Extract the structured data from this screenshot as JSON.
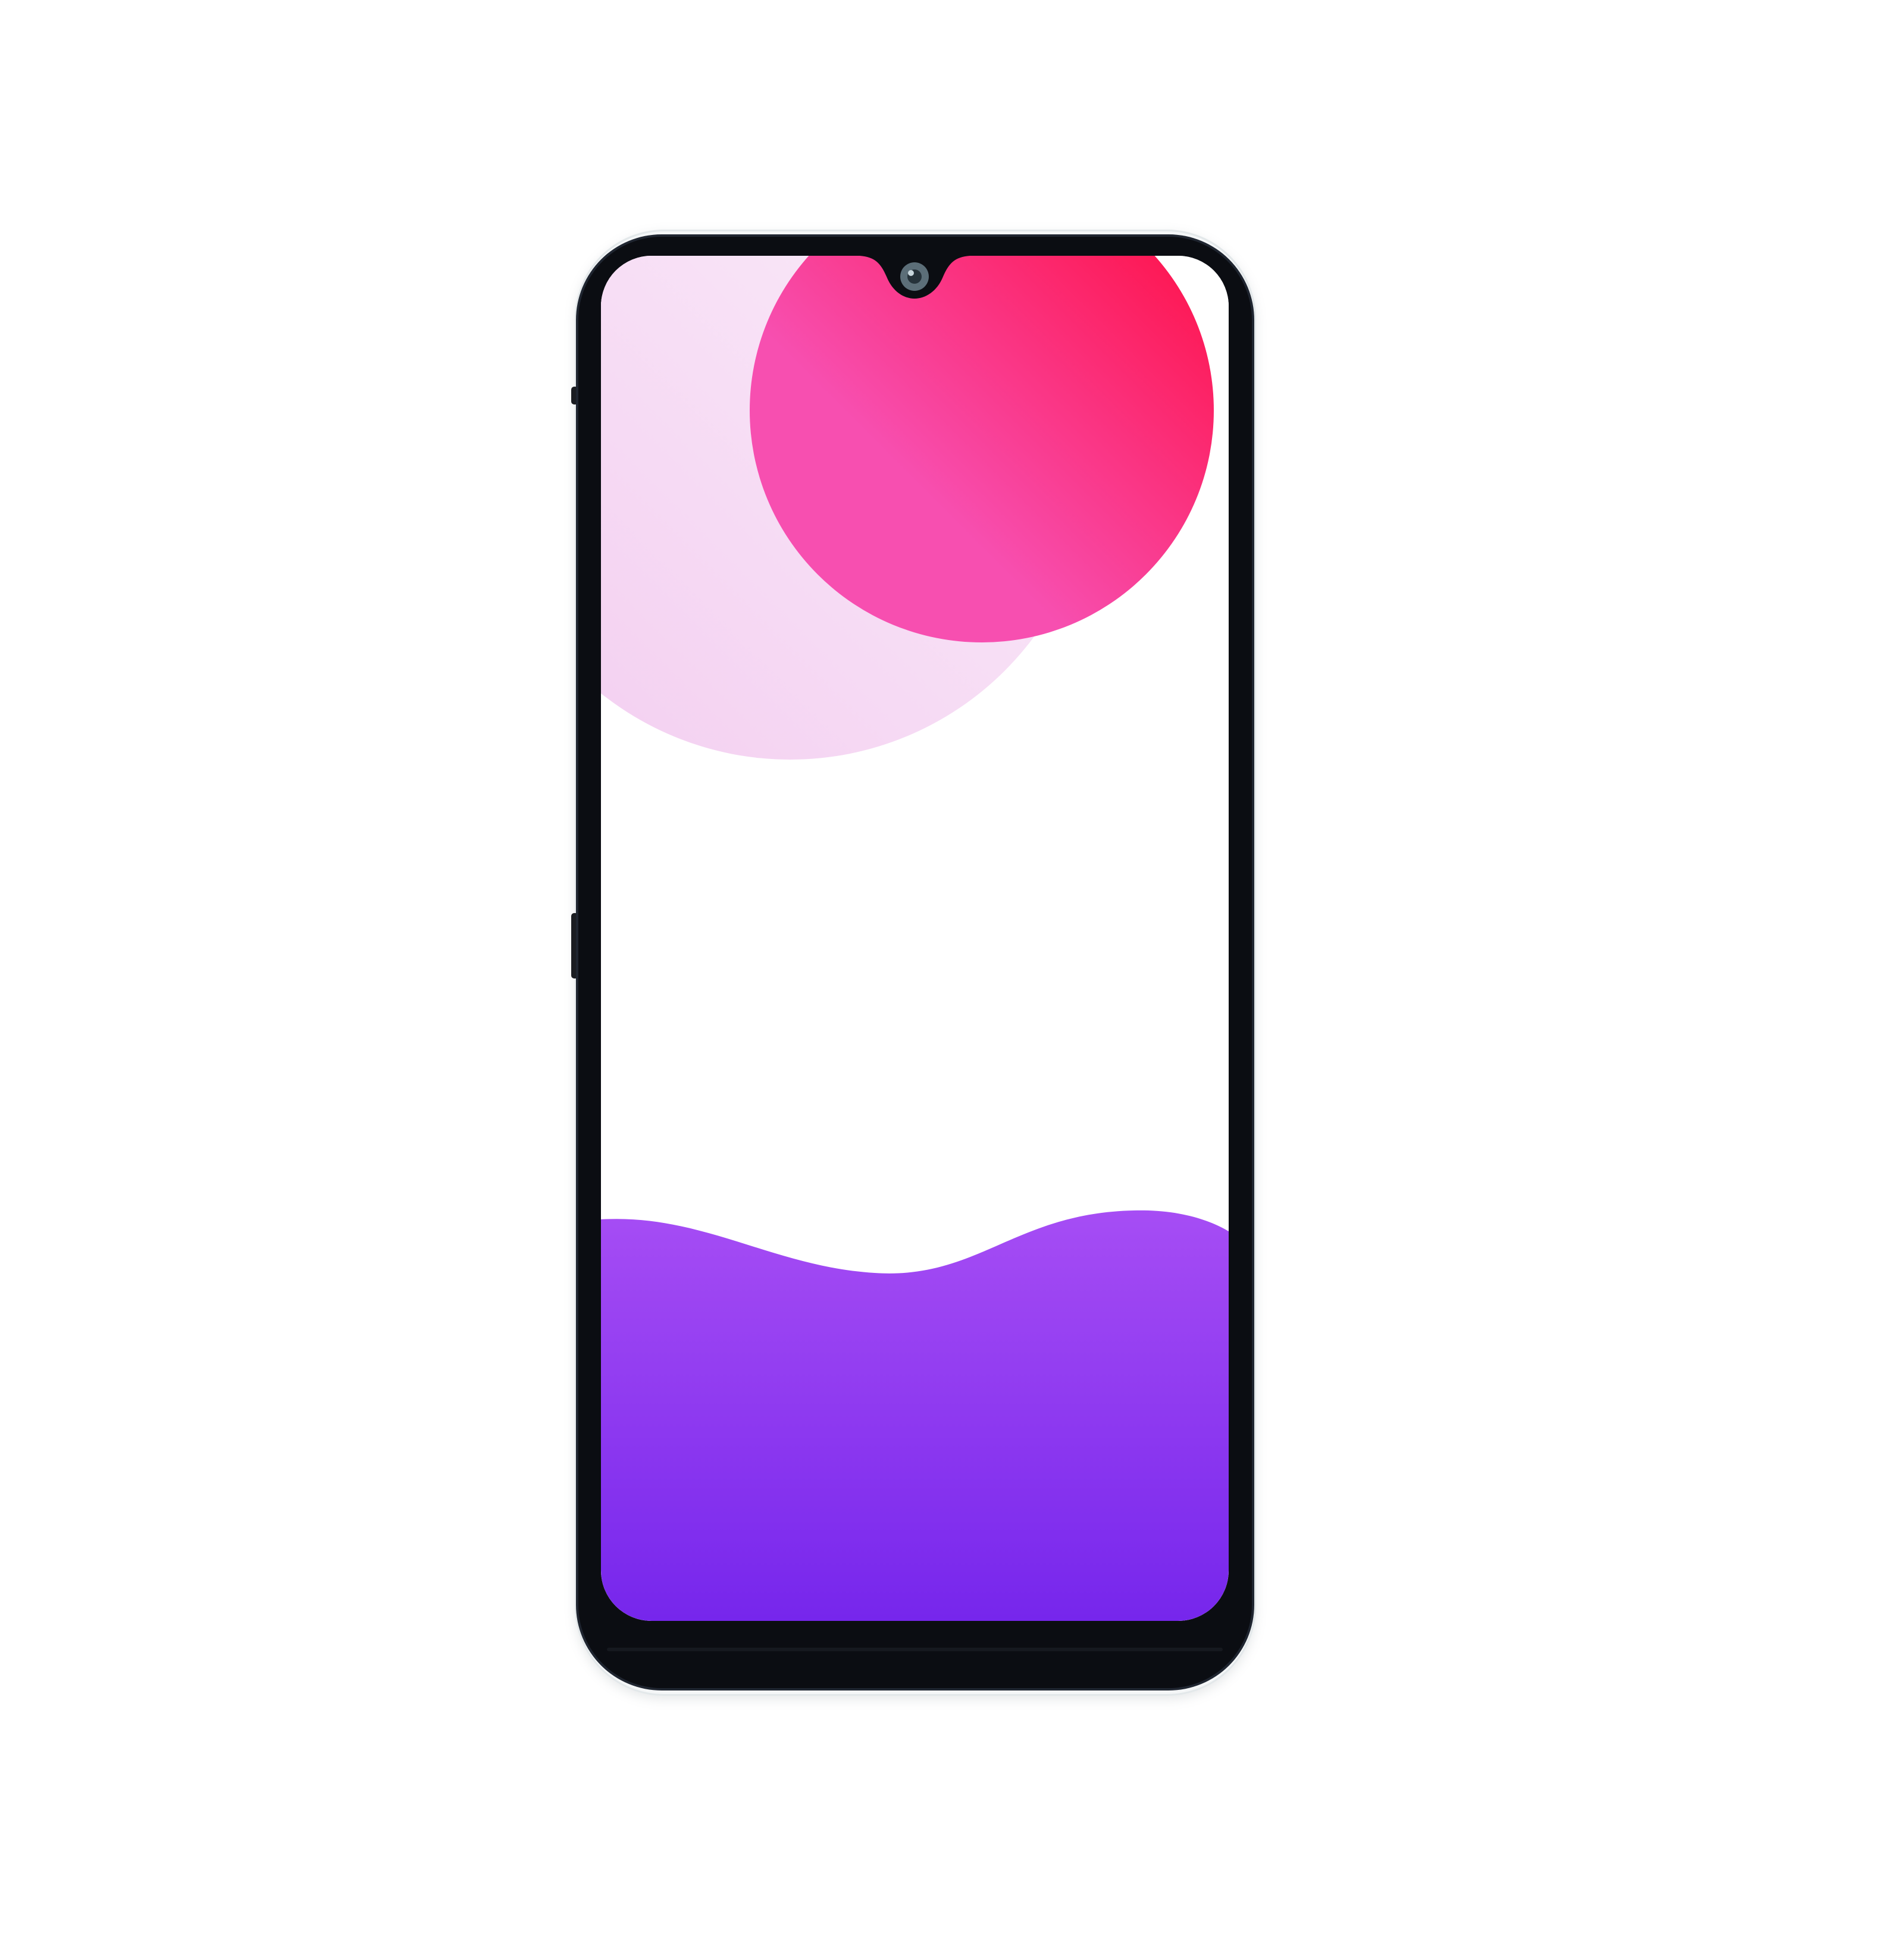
{
  "device": {
    "type": "smartphone",
    "orientation": "portrait",
    "notch_style": "waterdrop"
  },
  "wallpaper": {
    "background_color": "#ffffff",
    "shapes": [
      {
        "kind": "circle",
        "name": "magenta-sun",
        "colors": [
          "#f74fb0",
          "#ff0a3c"
        ]
      },
      {
        "kind": "circle",
        "name": "lilac-halo",
        "colors": [
          "#f3cdf0",
          "#f9eaf8"
        ]
      },
      {
        "kind": "wave",
        "name": "violet-wave",
        "colors": [
          "#a64df4",
          "#7626ec"
        ]
      }
    ]
  },
  "colors": {
    "bezel": "#0b0d12",
    "frame": "#f4f6f7",
    "camera": "#5c6e78"
  }
}
